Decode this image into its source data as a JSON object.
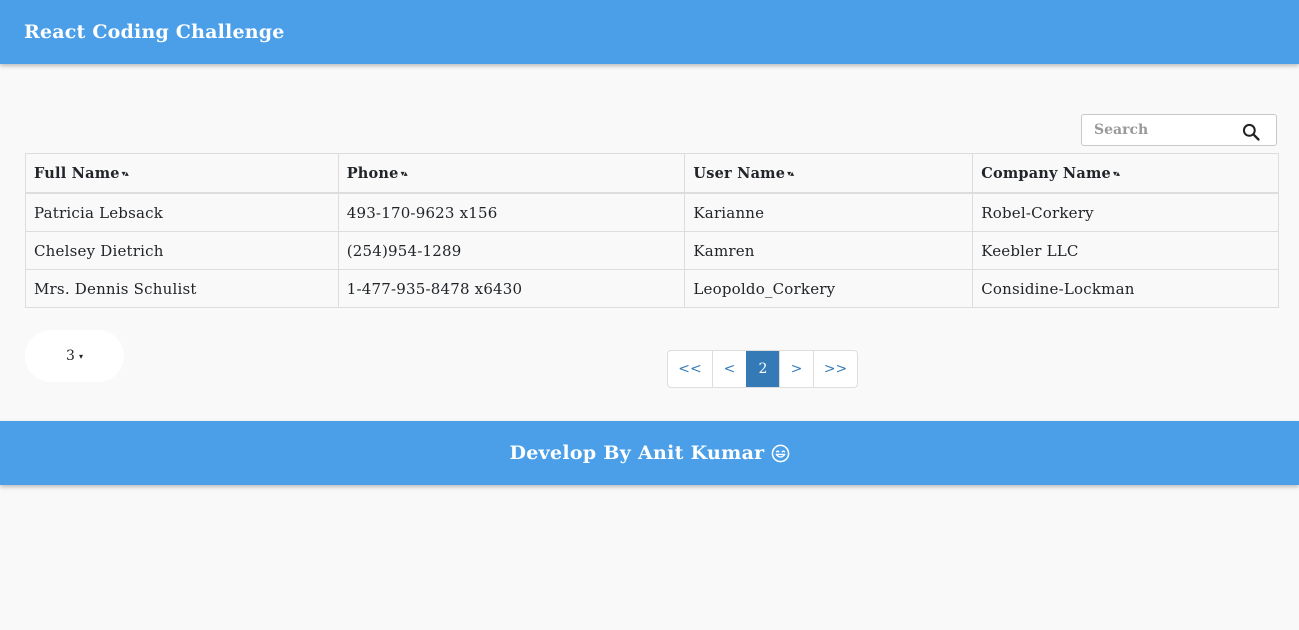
{
  "header": {
    "title": "React Coding Challenge"
  },
  "search": {
    "placeholder": "Search",
    "value": "",
    "icon": "search-icon"
  },
  "table": {
    "columns": [
      {
        "label": "Full Name",
        "sort_caret": "▾▴"
      },
      {
        "label": "Phone",
        "sort_caret": "▾▴"
      },
      {
        "label": "User Name",
        "sort_caret": "▾▴"
      },
      {
        "label": "Company Name",
        "sort_caret": "▾▴"
      }
    ],
    "rows": [
      {
        "full_name": "Patricia Lebsack",
        "phone": "493-170-9623 x156",
        "user_name": "Karianne",
        "company": "Robel-Corkery"
      },
      {
        "full_name": "Chelsey Dietrich",
        "phone": "(254)954-1289",
        "user_name": "Kamren",
        "company": "Keebler LLC"
      },
      {
        "full_name": "Mrs. Dennis Schulist",
        "phone": "1-477-935-8478 x6430",
        "user_name": "Leopoldo_Corkery",
        "company": "Considine-Lockman"
      }
    ]
  },
  "page_size": {
    "value": "3",
    "caret": "▾"
  },
  "pagination": {
    "first": "<<",
    "prev": "<",
    "current": "2",
    "next": ">",
    "last": ">>"
  },
  "footer": {
    "text": "Develop By Anit Kumar",
    "icon": "smile-icon"
  },
  "colors": {
    "header_bg": "#4a9fe8",
    "footer_bg": "#4a9fe8",
    "page_active": "#337ab7",
    "page_link": "#337ab7",
    "background": "#f9f9f9"
  }
}
